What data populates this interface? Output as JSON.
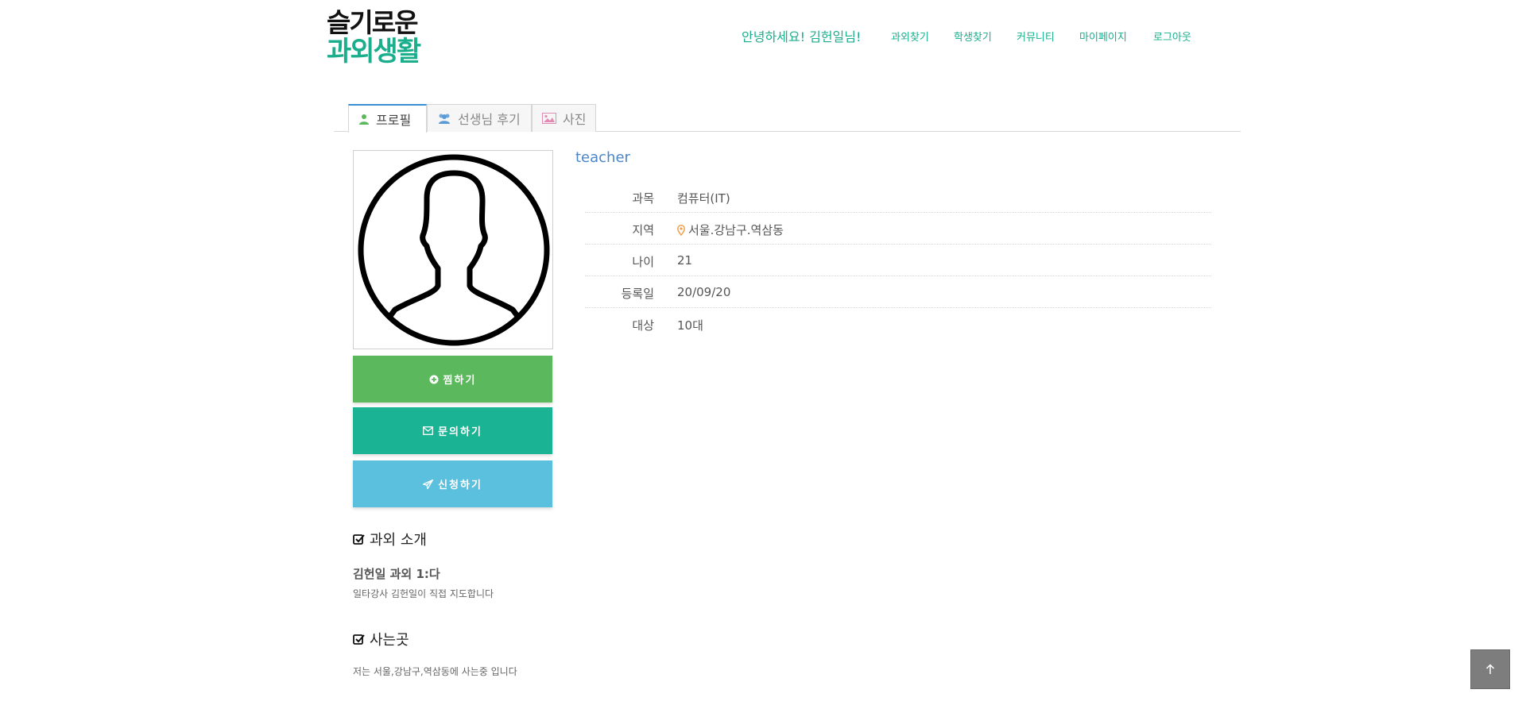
{
  "logo": {
    "line1": "슬기로운",
    "line2": "과외생활"
  },
  "header": {
    "greeting": "안녕하세요! 김헌일님!",
    "nav": [
      "과외찾기",
      "학생찾기",
      "커뮤니티",
      "마이페이지",
      "로그아웃"
    ]
  },
  "tabs": [
    {
      "label": "프로필",
      "icon": "user-icon",
      "active": true
    },
    {
      "label": "선생님 후기",
      "icon": "users-icon",
      "active": false
    },
    {
      "label": "사진",
      "icon": "image-icon",
      "active": false
    }
  ],
  "profile": {
    "role": "teacher",
    "fields": [
      {
        "key": "과목",
        "value": "컴퓨터(IT)"
      },
      {
        "key": "지역",
        "value": "서울.강남구.역삼동",
        "icon": "map-marker-icon"
      },
      {
        "key": "나이",
        "value": "21"
      },
      {
        "key": "등록일",
        "value": "20/09/20"
      },
      {
        "key": "대상",
        "value": "10대"
      }
    ]
  },
  "actions": {
    "like": "찜하기",
    "ask": "문의하기",
    "apply": "신청하기"
  },
  "sections": {
    "intro_title": "과외 소개",
    "intro_head": "김헌일 과외 1:다",
    "intro_body": "일타강사 김헌일이 직접 지도합니다",
    "live_title": "사는곳",
    "live_body": "저는 서울,강남구,역삼동에 사는중 입니다"
  },
  "colors": {
    "brand": "#1aae8c",
    "like": "#5cb85c",
    "ask": "#1ab394",
    "apply": "#5bc0de",
    "role": "#4a86c8",
    "marker": "#f0a050"
  }
}
